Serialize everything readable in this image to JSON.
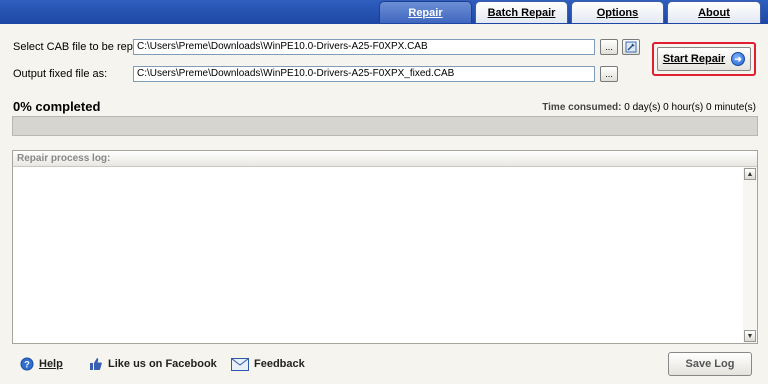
{
  "tabs": [
    {
      "label": "Repair",
      "active": true
    },
    {
      "label": "Batch Repair",
      "active": false
    },
    {
      "label": "Options",
      "active": false
    },
    {
      "label": "About",
      "active": false
    }
  ],
  "form": {
    "cab_label": "Select CAB file to be repaired:",
    "cab_value": "C:\\Users\\Preme\\Downloads\\WinPE10.0-Drivers-A25-F0XPX.CAB",
    "output_label": "Output fixed file as:",
    "output_value": "C:\\Users\\Preme\\Downloads\\WinPE10.0-Drivers-A25-F0XPX_fixed.CAB",
    "browse_label": "..."
  },
  "start_button": {
    "label": "Start Repair"
  },
  "progress": {
    "percent_text": "0% completed",
    "value": 0,
    "time_label": "Time consumed:",
    "time_value": "0 day(s) 0 hour(s) 0 minute(s)"
  },
  "log": {
    "header": "Repair process log:"
  },
  "footer": {
    "help": "Help",
    "facebook": "Like us on Facebook",
    "feedback": "Feedback",
    "save_log": "Save Log"
  },
  "colors": {
    "header_blue": "#1d47a3",
    "highlight_red": "#e02030"
  }
}
